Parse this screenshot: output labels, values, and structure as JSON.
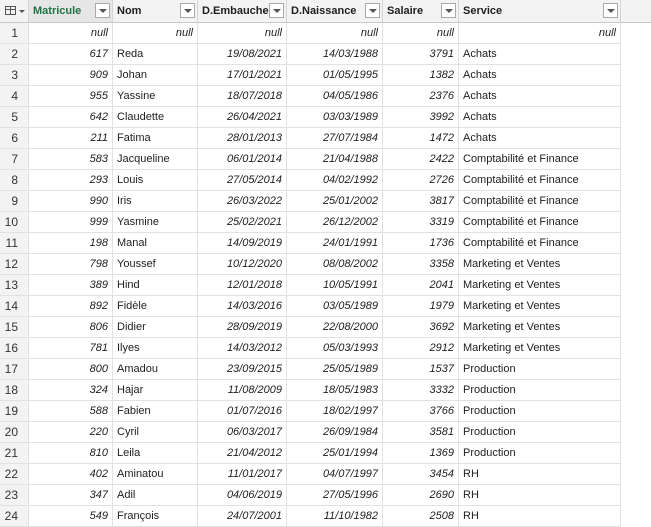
{
  "columns": [
    {
      "label": "Matricule"
    },
    {
      "label": "Nom"
    },
    {
      "label": "D.Embauche"
    },
    {
      "label": "D.Naissance"
    },
    {
      "label": "Salaire"
    },
    {
      "label": "Service"
    }
  ],
  "null_text": "null",
  "rows": [
    {
      "n": "1",
      "mat": "null",
      "nom": "null",
      "emb": "null",
      "nai": "null",
      "sal": "null",
      "srv": "null"
    },
    {
      "n": "2",
      "mat": "617",
      "nom": "Reda",
      "emb": "19/08/2021",
      "nai": "14/03/1988",
      "sal": "3791",
      "srv": "Achats"
    },
    {
      "n": "3",
      "mat": "909",
      "nom": "Johan",
      "emb": "17/01/2021",
      "nai": "01/05/1995",
      "sal": "1382",
      "srv": "Achats"
    },
    {
      "n": "4",
      "mat": "955",
      "nom": "Yassine",
      "emb": "18/07/2018",
      "nai": "04/05/1986",
      "sal": "2376",
      "srv": "Achats"
    },
    {
      "n": "5",
      "mat": "642",
      "nom": "Claudette",
      "emb": "26/04/2021",
      "nai": "03/03/1989",
      "sal": "3992",
      "srv": "Achats"
    },
    {
      "n": "6",
      "mat": "211",
      "nom": "Fatima",
      "emb": "28/01/2013",
      "nai": "27/07/1984",
      "sal": "1472",
      "srv": "Achats"
    },
    {
      "n": "7",
      "mat": "583",
      "nom": "Jacqueline",
      "emb": "06/01/2014",
      "nai": "21/04/1988",
      "sal": "2422",
      "srv": "Comptabilité et Finance"
    },
    {
      "n": "8",
      "mat": "293",
      "nom": "Louis",
      "emb": "27/05/2014",
      "nai": "04/02/1992",
      "sal": "2726",
      "srv": "Comptabilité et Finance"
    },
    {
      "n": "9",
      "mat": "990",
      "nom": "Iris",
      "emb": "26/03/2022",
      "nai": "25/01/2002",
      "sal": "3817",
      "srv": "Comptabilité et Finance"
    },
    {
      "n": "10",
      "mat": "999",
      "nom": "Yasmine",
      "emb": "25/02/2021",
      "nai": "26/12/2002",
      "sal": "3319",
      "srv": "Comptabilité et Finance"
    },
    {
      "n": "11",
      "mat": "198",
      "nom": "Manal",
      "emb": "14/09/2019",
      "nai": "24/01/1991",
      "sal": "1736",
      "srv": "Comptabilité et Finance"
    },
    {
      "n": "12",
      "mat": "798",
      "nom": "Youssef",
      "emb": "10/12/2020",
      "nai": "08/08/2002",
      "sal": "3358",
      "srv": "Marketing et Ventes"
    },
    {
      "n": "13",
      "mat": "389",
      "nom": "Hind",
      "emb": "12/01/2018",
      "nai": "10/05/1991",
      "sal": "2041",
      "srv": "Marketing et Ventes"
    },
    {
      "n": "14",
      "mat": "892",
      "nom": "Fidèle",
      "emb": "14/03/2016",
      "nai": "03/05/1989",
      "sal": "1979",
      "srv": "Marketing et Ventes"
    },
    {
      "n": "15",
      "mat": "806",
      "nom": "Didier",
      "emb": "28/09/2019",
      "nai": "22/08/2000",
      "sal": "3692",
      "srv": "Marketing et Ventes"
    },
    {
      "n": "16",
      "mat": "781",
      "nom": "Ilyes",
      "emb": "14/03/2012",
      "nai": "05/03/1993",
      "sal": "2912",
      "srv": "Marketing et Ventes"
    },
    {
      "n": "17",
      "mat": "800",
      "nom": "Amadou",
      "emb": "23/09/2015",
      "nai": "25/05/1989",
      "sal": "1537",
      "srv": "Production"
    },
    {
      "n": "18",
      "mat": "324",
      "nom": "Hajar",
      "emb": "11/08/2009",
      "nai": "18/05/1983",
      "sal": "3332",
      "srv": "Production"
    },
    {
      "n": "19",
      "mat": "588",
      "nom": "Fabien",
      "emb": "01/07/2016",
      "nai": "18/02/1997",
      "sal": "3766",
      "srv": "Production"
    },
    {
      "n": "20",
      "mat": "220",
      "nom": "Cyril",
      "emb": "06/03/2017",
      "nai": "26/09/1984",
      "sal": "3581",
      "srv": "Production"
    },
    {
      "n": "21",
      "mat": "810",
      "nom": "Leila",
      "emb": "21/04/2012",
      "nai": "25/01/1994",
      "sal": "1369",
      "srv": "Production"
    },
    {
      "n": "22",
      "mat": "402",
      "nom": "Aminatou",
      "emb": "11/01/2017",
      "nai": "04/07/1997",
      "sal": "3454",
      "srv": "RH"
    },
    {
      "n": "23",
      "mat": "347",
      "nom": "Adil",
      "emb": "04/06/2019",
      "nai": "27/05/1996",
      "sal": "2690",
      "srv": "RH"
    },
    {
      "n": "24",
      "mat": "549",
      "nom": "François",
      "emb": "24/07/2001",
      "nai": "11/10/1982",
      "sal": "2508",
      "srv": "RH"
    }
  ],
  "colors": {
    "selected_header": "#217346",
    "header_bg": "#f3f3f3",
    "grid_line": "#e1e1e1"
  },
  "icons": {
    "corner": "table-icon",
    "column_filter": "chevron-down-icon"
  }
}
